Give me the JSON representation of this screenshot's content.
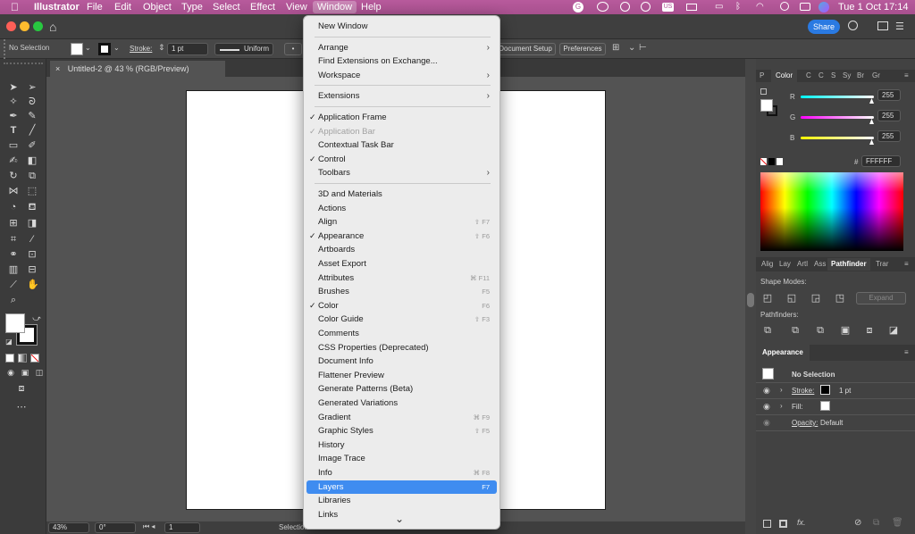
{
  "menubar": {
    "app_name": "Illustrator",
    "items": [
      "File",
      "Edit",
      "Object",
      "Type",
      "Select",
      "Effect",
      "View",
      "Window",
      "Help"
    ],
    "active_item": "Window",
    "clock": "Tue 1 Oct  17:14"
  },
  "appbar": {
    "share_label": "Share"
  },
  "control": {
    "selection_label": "No Selection",
    "stroke_label": "Stroke:",
    "stroke_weight": "1 pt",
    "profile": "Uniform",
    "document_setup": "Document Setup",
    "preferences": "Preferences"
  },
  "document_tab": {
    "title": "Untitled-2 @ 43 % (RGB/Preview)",
    "close_glyph": "×"
  },
  "statusbar": {
    "zoom": "43%",
    "rotation": "0°",
    "page": "1",
    "mode": "Selection"
  },
  "window_menu": {
    "rows": [
      {
        "label": "New Window"
      },
      {
        "sep": true
      },
      {
        "label": "Arrange",
        "submenu": true
      },
      {
        "label": "Find Extensions on Exchange..."
      },
      {
        "label": "Workspace",
        "submenu": true
      },
      {
        "sep": true
      },
      {
        "label": "Extensions",
        "submenu": true
      },
      {
        "sep": true
      },
      {
        "label": "Application Frame",
        "checked": true
      },
      {
        "label": "Application Bar",
        "checked": true,
        "disabled": true
      },
      {
        "label": "Contextual Task Bar"
      },
      {
        "label": "Control",
        "checked": true
      },
      {
        "label": "Toolbars",
        "submenu": true
      },
      {
        "sep": true
      },
      {
        "label": "3D and Materials"
      },
      {
        "label": "Actions"
      },
      {
        "label": "Align",
        "shortcut": "⇧ F7"
      },
      {
        "label": "Appearance",
        "checked": true,
        "shortcut": "⇧ F6"
      },
      {
        "label": "Artboards"
      },
      {
        "label": "Asset Export"
      },
      {
        "label": "Attributes",
        "shortcut": "⌘ F11"
      },
      {
        "label": "Brushes",
        "shortcut": "F5"
      },
      {
        "label": "Color",
        "checked": true,
        "shortcut": "F6"
      },
      {
        "label": "Color Guide",
        "shortcut": "⇧ F3"
      },
      {
        "label": "Comments"
      },
      {
        "label": "CSS Properties (Deprecated)"
      },
      {
        "label": "Document Info"
      },
      {
        "label": "Flattener Preview"
      },
      {
        "label": "Generate Patterns (Beta)"
      },
      {
        "label": "Generated Variations"
      },
      {
        "label": "Gradient",
        "shortcut": "⌘ F9"
      },
      {
        "label": "Graphic Styles",
        "shortcut": "⇧ F5"
      },
      {
        "label": "History"
      },
      {
        "label": "Image Trace"
      },
      {
        "label": "Info",
        "shortcut": "⌘ F8"
      },
      {
        "label": "Layers",
        "shortcut": "F7",
        "highlighted": true
      },
      {
        "label": "Libraries"
      },
      {
        "label": "Links"
      }
    ],
    "more_glyph": "⌄"
  },
  "color_panel": {
    "tabs": [
      "P",
      "Color",
      "C",
      "C",
      "S",
      "Sy",
      "Br",
      "Gr"
    ],
    "active_tab": "Color",
    "channels": [
      {
        "label": "R",
        "value": "255"
      },
      {
        "label": "G",
        "value": "255"
      },
      {
        "label": "B",
        "value": "255"
      }
    ],
    "hex_symbol": "#",
    "hex": "FFFFFF"
  },
  "pathfinder_panel": {
    "tabs": [
      "Alig",
      "Lay",
      "Artl",
      "Ass",
      "Pathfinder",
      "Trar"
    ],
    "active_tab": "Pathfinder",
    "shape_modes_label": "Shape Modes:",
    "expand_label": "Expand",
    "pathfinders_label": "Pathfinders:"
  },
  "appearance_panel": {
    "title": "Appearance",
    "selection": "No Selection",
    "stroke_label": "Stroke:",
    "stroke_weight": "1 pt",
    "fill_label": "Fill:",
    "opacity_label": "Opacity:",
    "opacity_value": "Default",
    "fx_label": "fx."
  },
  "colors": {
    "menubar": "#b05596",
    "highlight": "#3f8cf0",
    "share": "#2a7ae2"
  }
}
